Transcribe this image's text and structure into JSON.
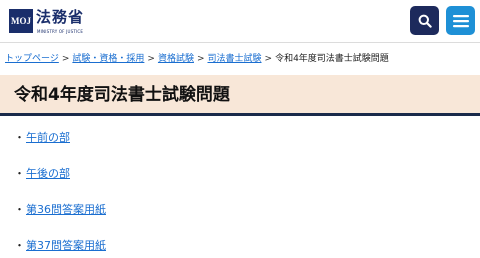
{
  "header": {
    "logo_title": "法務省",
    "logo_subtitle": "MINISTRY OF JUSTICE",
    "logo_mark_text": "MOJ",
    "search_icon": "search-icon",
    "menu_icon": "hamburger-menu-icon",
    "colors": {
      "search_button": "#1d2a5c",
      "menu_button": "#1e90d6"
    }
  },
  "breadcrumb": {
    "items": [
      "トップページ",
      "試験・資格・採用",
      "資格試験",
      "司法書士試験"
    ],
    "separator": ">",
    "current": "令和4年度司法書士試験問題"
  },
  "page": {
    "title": "令和4年度司法書士試験問題",
    "title_bg": "#f8e7d8"
  },
  "links": {
    "bullet": "・",
    "items": [
      "午前の部",
      "午後の部",
      "第36問答案用紙",
      "第37問答案用紙"
    ]
  }
}
